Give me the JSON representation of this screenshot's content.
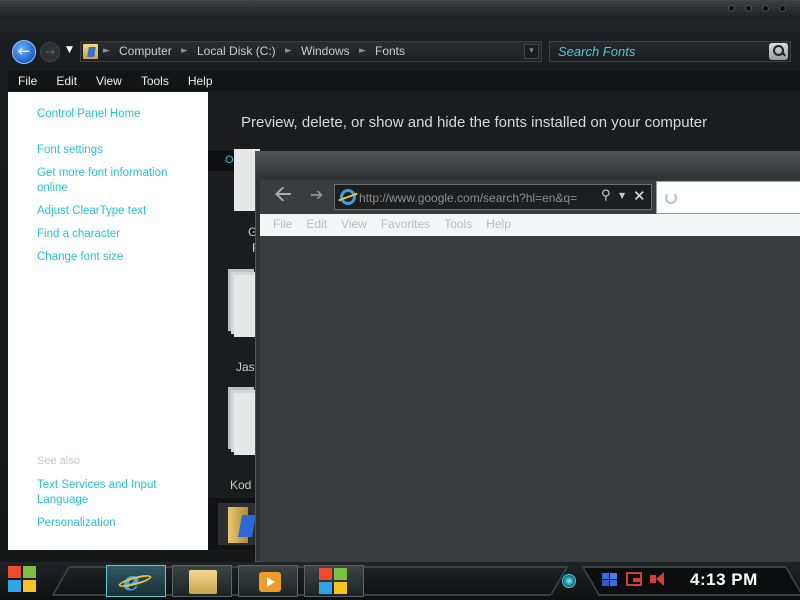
{
  "explorer": {
    "breadcrumbs": [
      "Computer",
      "Local Disk (C:)",
      "Windows",
      "Fonts"
    ],
    "search_placeholder": "Search Fonts",
    "menu": [
      "File",
      "Edit",
      "View",
      "Tools",
      "Help"
    ],
    "sidebar_links": {
      "control_panel_home": "Control Panel Home",
      "font_settings": "Font settings",
      "more_font_info": "Get more font information online",
      "cleartype": "Adjust ClearType text",
      "find_character": "Find a character",
      "font_size": "Change font size"
    },
    "see_also_label": "See also",
    "see_also_links": {
      "text_services": "Text Services and Input Language",
      "personalization": "Personalization"
    },
    "header": "Preview, delete, or show and hide the fonts installed on your computer",
    "organize_label": "Organ",
    "tiles": [
      "G",
      "F",
      "Jas",
      "Kod"
    ]
  },
  "ie": {
    "url": "http://www.google.com/search?hl=en&q=",
    "menu": [
      "File",
      "Edit",
      "View",
      "Favorites",
      "Tools",
      "Help"
    ]
  },
  "taskbar": {
    "clock": "4:13 PM"
  },
  "colors": {
    "link": "#26c3cf",
    "search_text": "#4fc9d4",
    "window_bg": "#1a1c1e",
    "ie_content": "#3a3d3f"
  }
}
